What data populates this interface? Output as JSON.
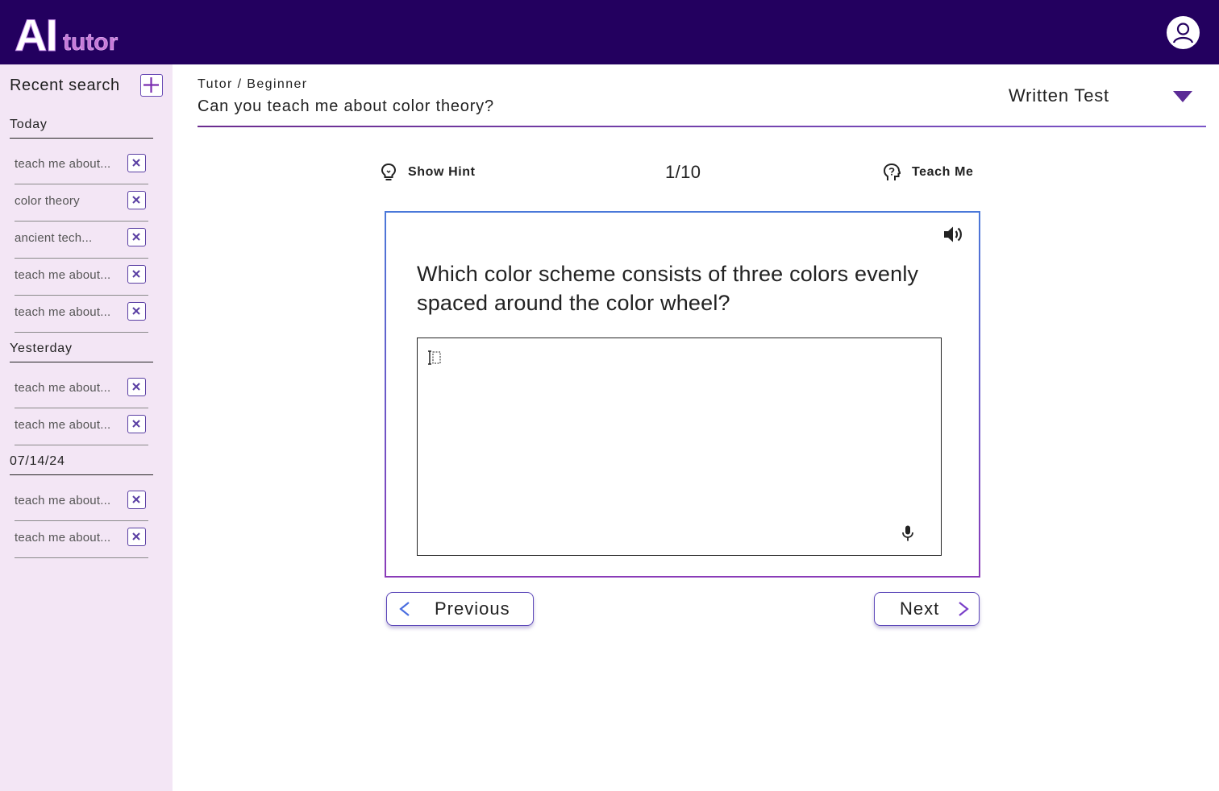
{
  "app": {
    "logo_ai": "AI",
    "logo_tutor": "tutor"
  },
  "sidebar": {
    "title": "Recent search",
    "sections": [
      {
        "heading": "Today",
        "items": [
          "teach me about...",
          "color theory",
          "ancient tech...",
          "teach me about...",
          "teach me about..."
        ]
      },
      {
        "heading": "Yesterday",
        "items": [
          "teach me about...",
          "teach me about..."
        ]
      },
      {
        "heading": "07/14/24",
        "items": [
          "teach me about...",
          "teach me about..."
        ]
      }
    ]
  },
  "header": {
    "breadcrumb": "Tutor / Beginner",
    "title": "Can you teach me about color theory?",
    "mode": "Written Test"
  },
  "toolbar": {
    "hint_label": "Show Hint",
    "counter": "1/10",
    "teach_label": "Teach Me"
  },
  "question": {
    "text": "Which color scheme consists of three colors evenly spaced around the color wheel?",
    "answer_value": ""
  },
  "nav": {
    "previous_label": "Previous",
    "next_label": "Next"
  },
  "colors": {
    "topbar": "#23005f",
    "sidebar": "#f3e6f5",
    "accent": "#5a3fa3"
  }
}
